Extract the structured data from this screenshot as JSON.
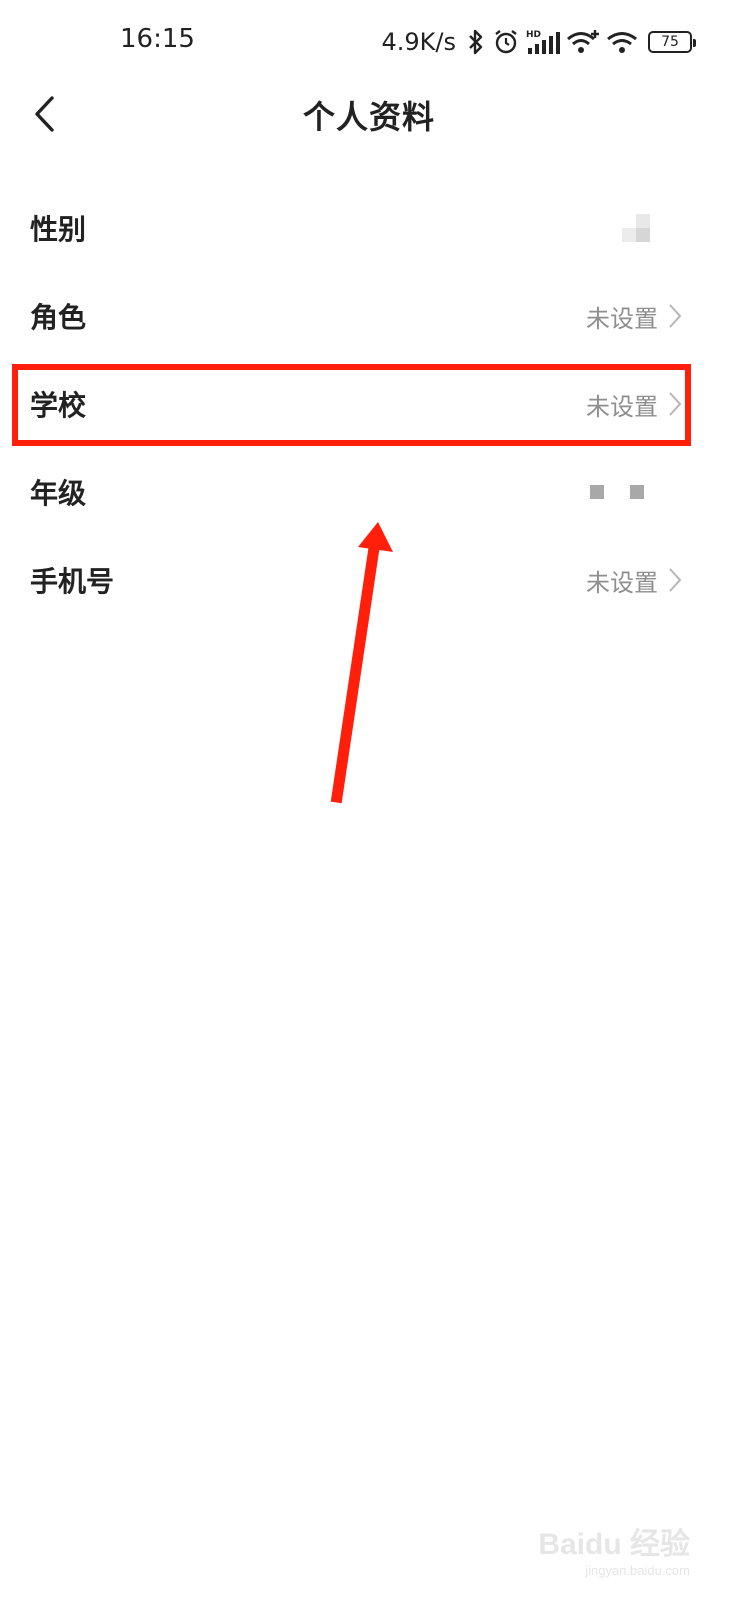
{
  "status_bar": {
    "time": "16:15",
    "net_speed": "4.9K/s",
    "battery": "75",
    "icons": [
      "bluetooth-icon",
      "alarm-icon",
      "hd-signal-icon",
      "wifi-plus-icon",
      "wifi-icon",
      "battery-icon"
    ]
  },
  "header": {
    "back_icon": "chevron-left-icon",
    "title": "个人资料"
  },
  "profile": {
    "rows": [
      {
        "label": "性别",
        "value": "",
        "obscured": true
      },
      {
        "label": "角色",
        "value": "未设置"
      },
      {
        "label": "学校",
        "value": "未设置",
        "highlighted": true
      },
      {
        "label": "年级",
        "value": "",
        "obscured": true
      },
      {
        "label": "手机号",
        "value": "未设置"
      }
    ]
  },
  "annotation": {
    "highlight_color": "#ff1f0a",
    "arrow_color": "#ff1f0a"
  },
  "watermark": {
    "brand": "Baidu 经验",
    "domain": "jingyan.baidu.com"
  }
}
